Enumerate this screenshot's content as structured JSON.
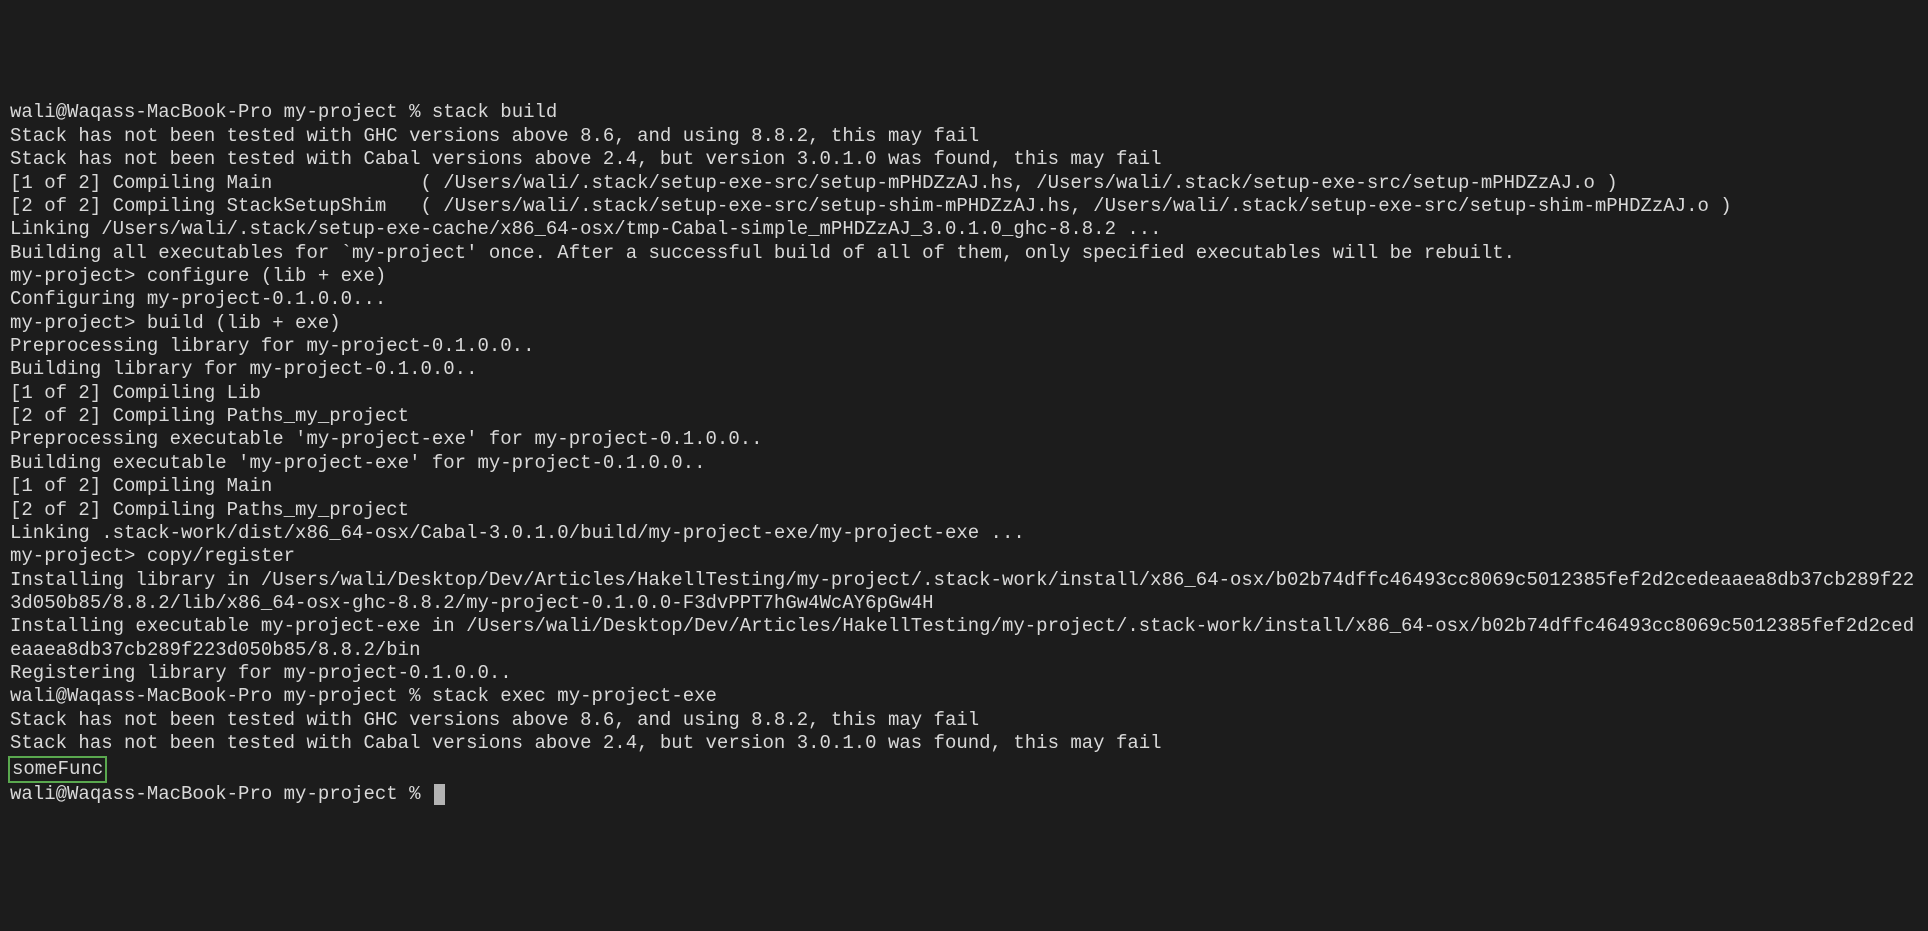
{
  "lines": {
    "l1_prompt": "wali@Waqass-MacBook-Pro my-project % ",
    "l1_cmd": "stack build",
    "l2": "Stack has not been tested with GHC versions above 8.6, and using 8.8.2, this may fail",
    "l3": "Stack has not been tested with Cabal versions above 2.4, but version 3.0.1.0 was found, this may fail",
    "l4": "[1 of 2] Compiling Main             ( /Users/wali/.stack/setup-exe-src/setup-mPHDZzAJ.hs, /Users/wali/.stack/setup-exe-src/setup-mPHDZzAJ.o )",
    "l5": "[2 of 2] Compiling StackSetupShim   ( /Users/wali/.stack/setup-exe-src/setup-shim-mPHDZzAJ.hs, /Users/wali/.stack/setup-exe-src/setup-shim-mPHDZzAJ.o )",
    "l6": "Linking /Users/wali/.stack/setup-exe-cache/x86_64-osx/tmp-Cabal-simple_mPHDZzAJ_3.0.1.0_ghc-8.8.2 ...",
    "l7": "Building all executables for `my-project' once. After a successful build of all of them, only specified executables will be rebuilt.",
    "l8": "my-project> configure (lib + exe)",
    "l9": "Configuring my-project-0.1.0.0...",
    "l10": "my-project> build (lib + exe)",
    "l11": "Preprocessing library for my-project-0.1.0.0..",
    "l12": "Building library for my-project-0.1.0.0..",
    "l13": "[1 of 2] Compiling Lib",
    "l14": "[2 of 2] Compiling Paths_my_project",
    "l15": "Preprocessing executable 'my-project-exe' for my-project-0.1.0.0..",
    "l16": "Building executable 'my-project-exe' for my-project-0.1.0.0..",
    "l17": "[1 of 2] Compiling Main",
    "l18": "[2 of 2] Compiling Paths_my_project",
    "l19": "Linking .stack-work/dist/x86_64-osx/Cabal-3.0.1.0/build/my-project-exe/my-project-exe ...",
    "l20": "my-project> copy/register",
    "l21": "Installing library in /Users/wali/Desktop/Dev/Articles/HakellTesting/my-project/.stack-work/install/x86_64-osx/b02b74dffc46493cc8069c5012385fef2d2cedeaaea8db37cb289f223d050b85/8.8.2/lib/x86_64-osx-ghc-8.8.2/my-project-0.1.0.0-F3dvPPT7hGw4WcAY6pGw4H",
    "l22": "Installing executable my-project-exe in /Users/wali/Desktop/Dev/Articles/HakellTesting/my-project/.stack-work/install/x86_64-osx/b02b74dffc46493cc8069c5012385fef2d2cedeaaea8db37cb289f223d050b85/8.8.2/bin",
    "l23": "Registering library for my-project-0.1.0.0..",
    "l24_prompt": "wali@Waqass-MacBook-Pro my-project % ",
    "l24_cmd": "stack exec my-project-exe",
    "l25": "Stack has not been tested with GHC versions above 8.6, and using 8.8.2, this may fail",
    "l26": "Stack has not been tested with Cabal versions above 2.4, but version 3.0.1.0 was found, this may fail",
    "l27_highlighted": "someFunc",
    "l28_prompt": "wali@Waqass-MacBook-Pro my-project % "
  }
}
